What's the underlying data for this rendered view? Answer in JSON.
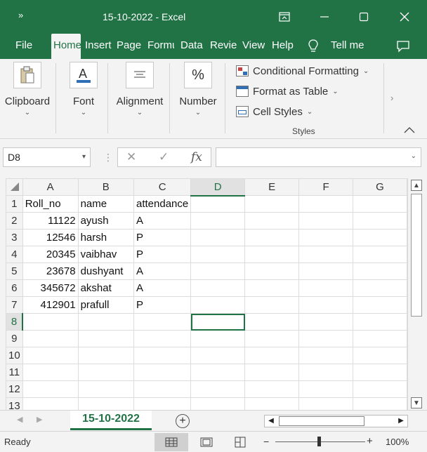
{
  "app": {
    "title": "15-10-2022  -  Excel",
    "accent": "#217346"
  },
  "titlebar": {
    "quick_access_icon": "chevron-double-right-icon",
    "icons": [
      "restore-ribbon-icon",
      "minimize-icon",
      "maximize-icon",
      "close-icon"
    ]
  },
  "menu": {
    "items": [
      "File",
      "Home",
      "Insert",
      "Page",
      "Formu",
      "Data",
      "Revie",
      "View",
      "Help",
      "Tell me"
    ],
    "active": "Home"
  },
  "ribbon": {
    "clipboard": "Clipboard",
    "font": "Font",
    "alignment": "Alignment",
    "number": "Number",
    "styles": {
      "conditional": "Conditional Formatting",
      "table": "Format as Table",
      "cell": "Cell Styles",
      "label": "Styles"
    }
  },
  "formula_bar": {
    "name_box": "D8",
    "fx": "fx",
    "value": ""
  },
  "sheet": {
    "columns": [
      "A",
      "B",
      "C",
      "D",
      "E",
      "F",
      "G"
    ],
    "active_cell": "D8",
    "rows": [
      {
        "n": "1",
        "a": "Roll_no",
        "b": "name",
        "c": "attendance"
      },
      {
        "n": "2",
        "a": "11122",
        "b": "ayush",
        "c": "A"
      },
      {
        "n": "3",
        "a": "12546",
        "b": "harsh",
        "c": "P"
      },
      {
        "n": "4",
        "a": "20345",
        "b": "vaibhav",
        "c": "P"
      },
      {
        "n": "5",
        "a": "23678",
        "b": "dushyant",
        "c": "A"
      },
      {
        "n": "6",
        "a": "345672",
        "b": "akshat",
        "c": "A"
      },
      {
        "n": "7",
        "a": "412901",
        "b": "prafull",
        "c": "P"
      },
      {
        "n": "8",
        "a": "",
        "b": "",
        "c": ""
      },
      {
        "n": "9",
        "a": "",
        "b": "",
        "c": ""
      },
      {
        "n": "10",
        "a": "",
        "b": "",
        "c": ""
      },
      {
        "n": "11",
        "a": "",
        "b": "",
        "c": ""
      },
      {
        "n": "12",
        "a": "",
        "b": "",
        "c": ""
      },
      {
        "n": "13",
        "a": "",
        "b": "",
        "c": ""
      }
    ]
  },
  "tabs": {
    "sheet_name": "15-10-2022"
  },
  "status": {
    "ready": "Ready",
    "zoom": "100%"
  }
}
